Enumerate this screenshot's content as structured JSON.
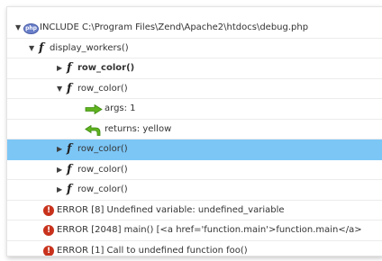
{
  "tree": {
    "include_prefix": "INCLUDE",
    "include_path": "C:\\Program Files\\Zend\\Apache2\\htdocs\\debug.php",
    "php_badge": "php",
    "function_glyph": "f",
    "nodes": [
      {
        "label": "display_workers()"
      },
      {
        "label": "row_color()"
      },
      {
        "label": "row_color()"
      },
      {
        "label": "args: 1"
      },
      {
        "label": "returns: yellow"
      },
      {
        "label": "row_color()"
      },
      {
        "label": "row_color()"
      },
      {
        "label": "row_color()"
      }
    ],
    "selected_index": 5
  },
  "errors": [
    {
      "text": "ERROR [8] Undefined variable: undefined_variable"
    },
    {
      "text": "ERROR [2048] main() [<a href='function.main'>function.main</a>"
    },
    {
      "text": "ERROR [1] Call to undefined function foo()"
    }
  ],
  "icons": {
    "expanded": "triangle-down-icon",
    "collapsed": "triangle-right-icon",
    "include": "php-file-icon",
    "function": "function-icon",
    "args": "green-arrow-right-icon",
    "returns": "green-return-arrow-icon",
    "error": "error-icon"
  },
  "colors": {
    "selection": "#7cc6f6",
    "error": "#c8321c",
    "arrow_green": "#5fb31f"
  }
}
